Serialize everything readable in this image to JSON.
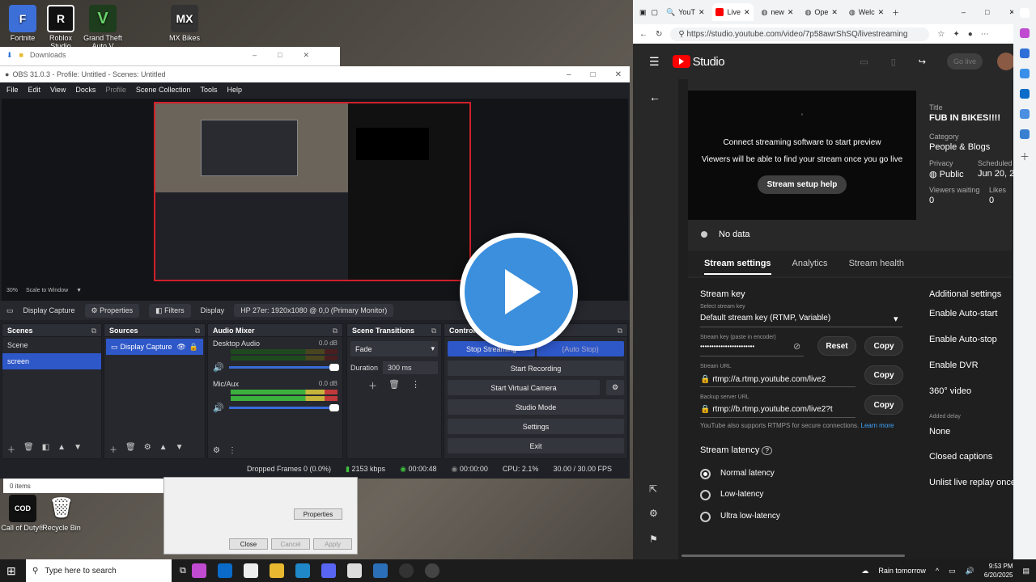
{
  "desktop": {
    "icons_top": [
      "Fortnite",
      "Roblox Studio",
      "Grand Theft Auto V",
      "MX Bikes"
    ],
    "icons_bottom": [
      "Call of Duty®",
      "Recycle Bin"
    ]
  },
  "explorer": {
    "title": "Downloads",
    "items_count": "0 items"
  },
  "obs": {
    "title": "OBS 31.0.3 - Profile: Untitled - Scenes: Untitled",
    "menu": [
      "File",
      "Edit",
      "View",
      "Docks",
      "Profile",
      "Scene Collection",
      "Tools",
      "Help"
    ],
    "zoom": "30%",
    "scale_mode": "Scale to Window",
    "source_name": "Display Capture",
    "properties_label": "Properties",
    "filters_label": "Filters",
    "display_label": "Display",
    "display_value": "HP 27er: 1920x1080 @ 0,0 (Primary Monitor)",
    "scenes": {
      "title": "Scenes",
      "items": [
        "Scene",
        "screen"
      ]
    },
    "sources": {
      "title": "Sources",
      "items": [
        "Display Capture"
      ]
    },
    "mixer": {
      "title": "Audio Mixer",
      "channels": [
        {
          "name": "Desktop Audio",
          "db": "0.0 dB"
        },
        {
          "name": "Mic/Aux",
          "db": "0.0 dB"
        }
      ]
    },
    "transitions": {
      "title": "Scene Transitions",
      "type": "Fade",
      "duration_label": "Duration",
      "duration": "300 ms"
    },
    "controls": {
      "title": "Controls",
      "buttons": [
        "Stop Streaming",
        "(Auto Stop)",
        "Start Recording",
        "Start Virtual Camera",
        "Studio Mode",
        "Settings",
        "Exit"
      ]
    },
    "status": {
      "dropped": "Dropped Frames 0 (0.0%)",
      "bitrate": "2153 kbps",
      "stream_time": "00:00:48",
      "rec_time": "00:00:00",
      "cpu": "CPU: 2.1%",
      "fps": "30.00 / 30.00 FPS"
    }
  },
  "properties_dialog": {
    "properties": "Properties",
    "close": "Close",
    "cancel": "Cancel",
    "apply": "Apply"
  },
  "browser": {
    "tabs": [
      "YouT",
      "Live",
      "new",
      "Ope",
      "Welc"
    ],
    "url": "https://studio.youtube.com/video/7p58awrShSQ/livestreaming"
  },
  "yt": {
    "studio": "Studio",
    "go_live": "Go live",
    "preview_line1": "Connect streaming software to start preview",
    "preview_line2": "Viewers will be able to find your stream once you go live",
    "setup_help": "Stream setup help",
    "no_data": "No data",
    "title_label": "Title",
    "title": "FUB IN BIKES!!!!",
    "category_label": "Category",
    "category": "People & Blogs",
    "privacy_label": "Privacy",
    "privacy": "Public",
    "scheduled_label": "Scheduled f",
    "scheduled": "Jun 20, 2",
    "waiting_label": "Viewers waiting",
    "waiting": "0",
    "likes_label": "Likes",
    "likes": "0",
    "tabs": [
      "Stream settings",
      "Analytics",
      "Stream health"
    ],
    "stream_key_heading": "Stream key",
    "select_key_label": "Select stream key",
    "select_key": "Default stream key (RTMP, Variable)",
    "key_label": "Stream key (paste in encoder)",
    "key": "••••••••••••••••••••••••",
    "reset": "Reset",
    "copy": "Copy",
    "url_label": "Stream URL",
    "url": "rtmp://a.rtmp.youtube.com/live2",
    "backup_label": "Backup server URL",
    "backup": "rtmp://b.rtmp.youtube.com/live2?t",
    "rtmps_note": "YouTube also supports RTMPS for secure connections.",
    "learn_more": "Learn more",
    "latency_heading": "Stream latency",
    "latency": [
      "Normal latency",
      "Low-latency",
      "Ultra low-latency"
    ],
    "additional_heading": "Additional settings",
    "additional": [
      "Enable Auto-start",
      "Enable Auto-stop",
      "Enable DVR",
      "360° video"
    ],
    "delay_label": "Added delay",
    "delay": "None",
    "captions": "Closed captions",
    "unlist": "Unlist live replay once"
  },
  "taskbar": {
    "search": "Type here to search",
    "weather": "Rain tomorrow",
    "time": "9:53 PM",
    "date": "6/20/2025"
  }
}
